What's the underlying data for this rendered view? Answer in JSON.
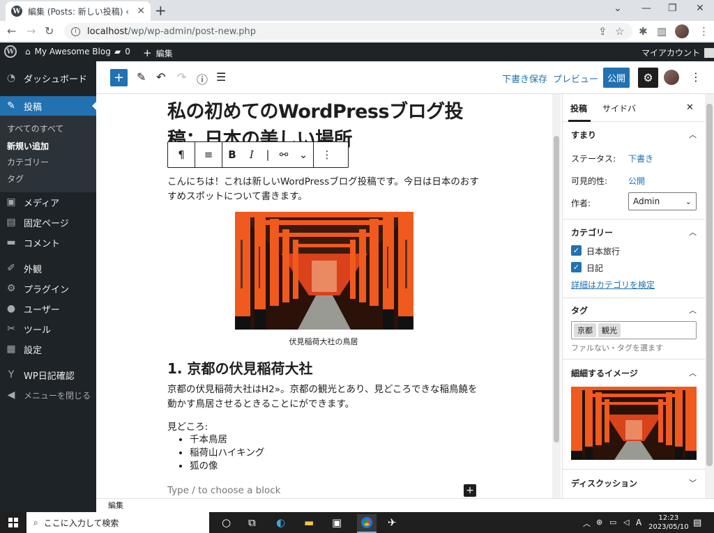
{
  "browser": {
    "tab_title": "編集 (Posts: 新しい投稿) ‹ My Awesome Blog",
    "favicon_letter": "W",
    "tab_close": "✕",
    "newtab": "+",
    "url_host": "localhost",
    "url_path": "/wp/wp-admin/post-new.php",
    "win_minimize": "⌄",
    "win_min": "—",
    "win_max": "❐",
    "win_close": "✕"
  },
  "adminbar": {
    "site_name": "My Awesome Blog",
    "comments_count": "0",
    "new_label": "編集",
    "account": "マイアカウント"
  },
  "wpmenu": {
    "items": [
      {
        "label": "ダッシュボード",
        "icon": "dashboard-icon",
        "glyph": "◔"
      },
      {
        "label": "投稿",
        "icon": "pin-icon",
        "glyph": "✎"
      },
      {
        "label": "メディア",
        "icon": "media-icon",
        "glyph": "▣"
      },
      {
        "label": "固定ページ",
        "icon": "page-icon",
        "glyph": "▤"
      },
      {
        "label": "コメント",
        "icon": "comment-icon",
        "glyph": "▬"
      },
      {
        "label": "外観",
        "icon": "brush-icon",
        "glyph": "✐"
      },
      {
        "label": "プラグイン",
        "icon": "plugin-icon",
        "glyph": "⚙"
      },
      {
        "label": "ユーザー",
        "icon": "user-icon",
        "glyph": "●"
      },
      {
        "label": "ツール",
        "icon": "wrench-icon",
        "glyph": "✂"
      },
      {
        "label": "設定",
        "icon": "settings-icon",
        "glyph": "▦"
      },
      {
        "label": "WP日記確認",
        "icon": "wp-icon",
        "glyph": "Y"
      },
      {
        "label": "メニューを閉じる",
        "icon": "collapse-icon",
        "glyph": "◀"
      }
    ],
    "submenu": [
      "すべてのすべて",
      "新規い追加",
      "カテゴリー",
      "タグ"
    ]
  },
  "editor": {
    "save_draft": "下書き保存",
    "preview": "プレビュー",
    "publish": "公開",
    "title": "私の初めてのWordPressブログ投稿：日本の美しい場所",
    "intro": "こんにちは！これは新しいWordPressブログ投稿です。今日は日本のおすすめスポットについて書きます。",
    "caption": "伏見稲荷大社の鳥居",
    "heading": "1. 京都の伏見稲荷大社",
    "para2": "京都の伏見稲荷大社はH2»。京都の観光とあり、見どころできな稲鳥饒を動かす鳥居させるときることにができます。",
    "highlights_label": "見どころ:",
    "highlights": [
      "千本鳥居",
      "稲荷山ハイキング",
      "狐の像"
    ],
    "appender_placeholder": "Type / to choose a block",
    "footer_breadcrumb": "編集"
  },
  "settings": {
    "tab_post": "投稿",
    "tab_block": "サイドバ",
    "summary_title": "すまり",
    "status_label": "ステータス:",
    "status_value": "下書き",
    "visibility_label": "可見的性:",
    "visibility_value": "公開",
    "author_label": "作者:",
    "author_value": "Admin",
    "categories_title": "カテゴリー",
    "categories": [
      "日本旅行",
      "日記"
    ],
    "categories_link": "詳細はカテゴリを検定",
    "tags_title": "タグ",
    "tags": [
      "京都",
      "観光"
    ],
    "tags_help": "ファルない・タグを選ます",
    "featured_title": "細細するイメージ",
    "discussion_title": "ディスクッション"
  },
  "taskbar": {
    "search_placeholder": "ここに入力して検索",
    "time": "12:23",
    "date": "2023/05/10",
    "ime": "A"
  },
  "colors": {
    "accent": "#2271b1",
    "admin_dark": "#1d2327",
    "torii_orange": "#e8501c"
  }
}
